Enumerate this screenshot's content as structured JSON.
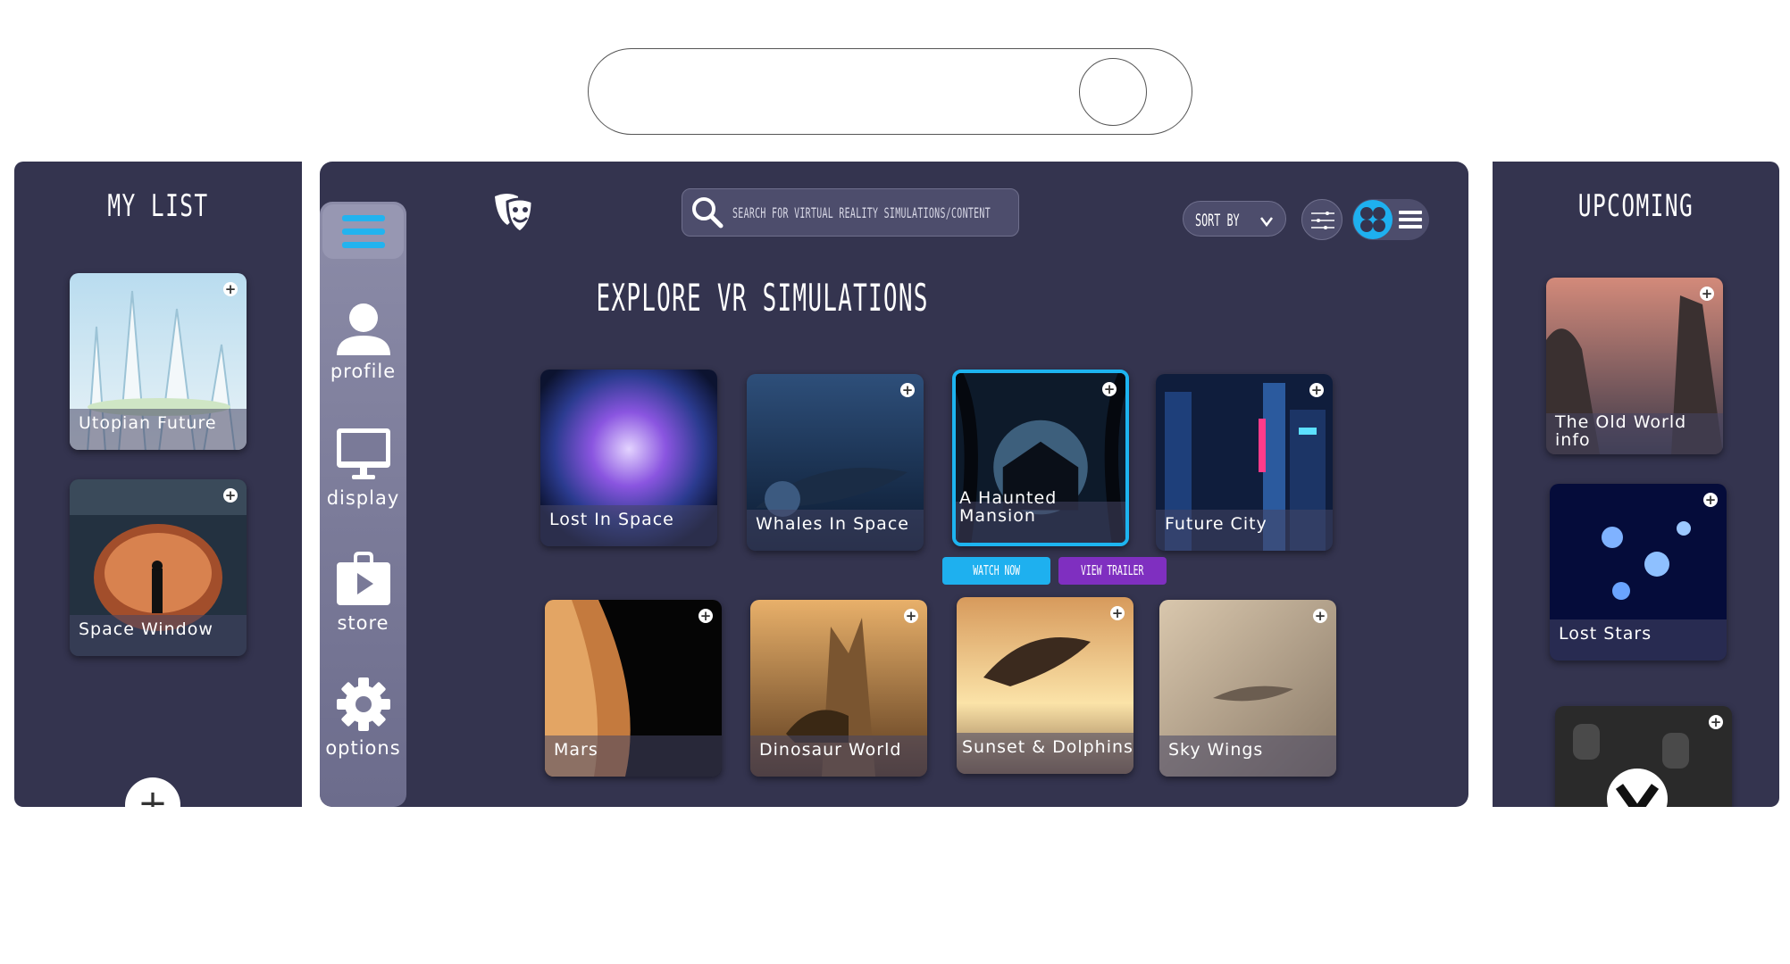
{
  "my_list": {
    "title": "MY LIST",
    "items": [
      {
        "label": "Utopian Future"
      },
      {
        "label": "Space Window"
      }
    ],
    "add_button": "+"
  },
  "rail": {
    "items": [
      {
        "label": "profile",
        "icon": "person-icon"
      },
      {
        "label": "display",
        "icon": "monitor-icon"
      },
      {
        "label": "store",
        "icon": "store-bag-icon"
      },
      {
        "label": "options",
        "icon": "gear-icon"
      }
    ]
  },
  "header": {
    "search_placeholder": "SEARCH FOR VIRTUAL REALITY SIMULATIONS/CONTENT",
    "sort_label": "SORT BY",
    "sort_chevron": "v"
  },
  "main": {
    "title": "EXPLORE VR SIMULATIONS",
    "row1": [
      {
        "label": "Lost In Space"
      },
      {
        "label": "Whales In Space"
      },
      {
        "label": "A Haunted Mansion"
      },
      {
        "label": "Future City"
      }
    ],
    "row2": [
      {
        "label": "Mars"
      },
      {
        "label": "Dinosaur World"
      },
      {
        "label": "Sunset & Dolphins"
      },
      {
        "label": "Sky Wings"
      }
    ],
    "watch_now": "WATCH NOW",
    "view_trailer": "VIEW TRAILER"
  },
  "upcoming": {
    "title": "UPCOMING",
    "items": [
      {
        "label": "The Old World info"
      },
      {
        "label": "Lost Stars"
      },
      {
        "label": ""
      }
    ]
  },
  "colors": {
    "panel": "#34344f",
    "accent_blue": "#1eb0ef",
    "accent_purple": "#7f2fc0"
  }
}
